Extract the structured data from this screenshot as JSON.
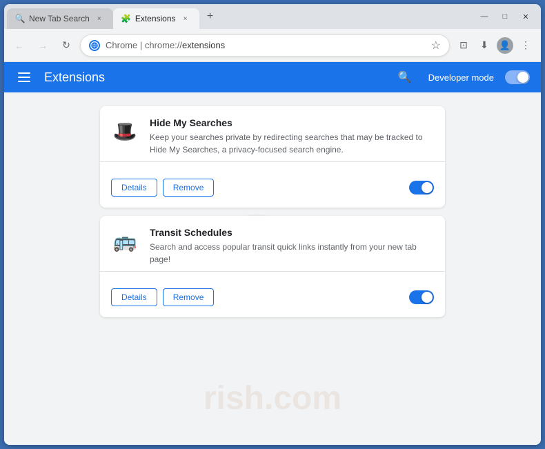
{
  "browser": {
    "tabs": [
      {
        "id": "tab-search",
        "label": "New Tab Search",
        "icon": "🔍",
        "active": false,
        "close": "×"
      },
      {
        "id": "tab-extensions",
        "label": "Extensions",
        "icon": "🧩",
        "active": true,
        "close": "×"
      }
    ],
    "new_tab_icon": "+",
    "window_controls": {
      "minimize": "—",
      "maximize": "□",
      "close": "✕"
    },
    "nav": {
      "back": "←",
      "forward": "→",
      "refresh": "↻"
    },
    "address": {
      "scheme": "Chrome | chrome://",
      "host": "extensions"
    },
    "toolbar": {
      "star": "☆",
      "screenshot": "⊡",
      "extension": "⬇",
      "menu": "⋮"
    }
  },
  "extensions_page": {
    "header": {
      "hamburger_label": "Menu",
      "title": "Extensions",
      "search_label": "Search",
      "dev_mode_label": "Developer mode"
    },
    "extensions": [
      {
        "id": "hide-my-searches",
        "name": "Hide My Searches",
        "description": "Keep your searches private by redirecting searches that may be tracked to Hide My Searches, a privacy-focused search engine.",
        "icon": "🎩",
        "enabled": true,
        "details_label": "Details",
        "remove_label": "Remove"
      },
      {
        "id": "transit-schedules",
        "name": "Transit Schedules",
        "description": "Search and access popular transit quick links instantly from your new tab page!",
        "icon": "🚌",
        "enabled": true,
        "details_label": "Details",
        "remove_label": "Remove"
      }
    ]
  }
}
